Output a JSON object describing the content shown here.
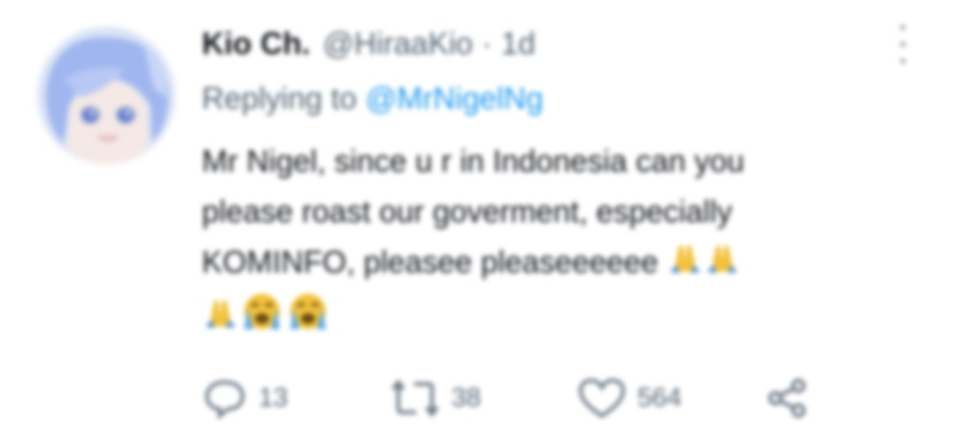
{
  "tweet": {
    "author_name": "Kio Ch.",
    "handle": "@HiraaKio",
    "separator": "·",
    "time": "1d",
    "replying_prefix": "Replying to ",
    "replying_to": "@MrNigelNg",
    "body_lines": [
      "Mr Nigel, since u r in Indonesia can you",
      "please roast our goverment, especially",
      "KOMINFO, pleasee pleaseeeeee"
    ],
    "emojis_line3": [
      "folded-hands",
      "folded-hands"
    ],
    "emojis_line4": [
      "folded-hands",
      "loudly-crying-face",
      "loudly-crying-face"
    ]
  },
  "actions": {
    "reply_count": "13",
    "retweet_count": "38",
    "like_count": "564"
  },
  "colors": {
    "text": "#0f1419",
    "secondary": "#536471",
    "link": "#1d9bf0",
    "avatar_bg": "#dfe7f7",
    "avatar_hair": "#9db4ee"
  }
}
